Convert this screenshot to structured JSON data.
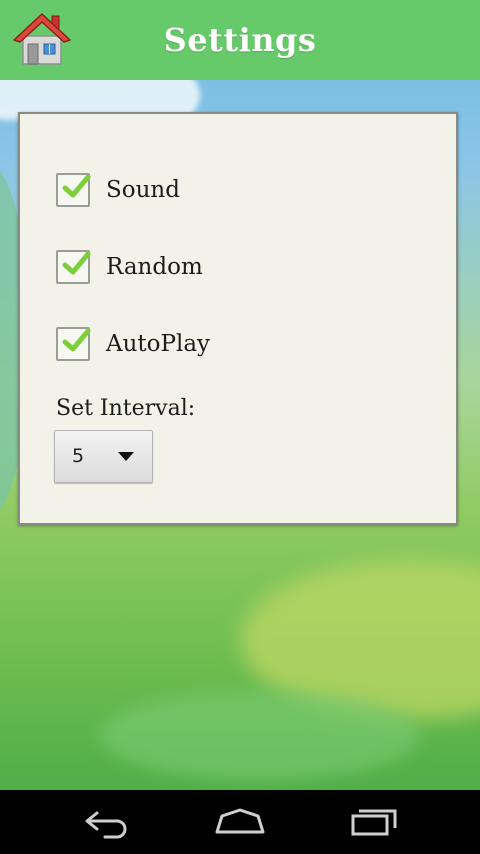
{
  "header": {
    "title": "Settings",
    "home_icon": "home-icon"
  },
  "settings": {
    "options": [
      {
        "label": "Sound",
        "checked": true
      },
      {
        "label": "Random",
        "checked": true
      },
      {
        "label": "AutoPlay",
        "checked": true
      }
    ],
    "interval": {
      "label": "Set Interval:",
      "value": "5"
    }
  },
  "nav": {
    "icons": [
      "back-icon",
      "home-icon",
      "recents-icon"
    ]
  },
  "colors": {
    "app_bar": "#66c96a",
    "check": "#7ccf3a",
    "panel": "#f2f2e8"
  }
}
